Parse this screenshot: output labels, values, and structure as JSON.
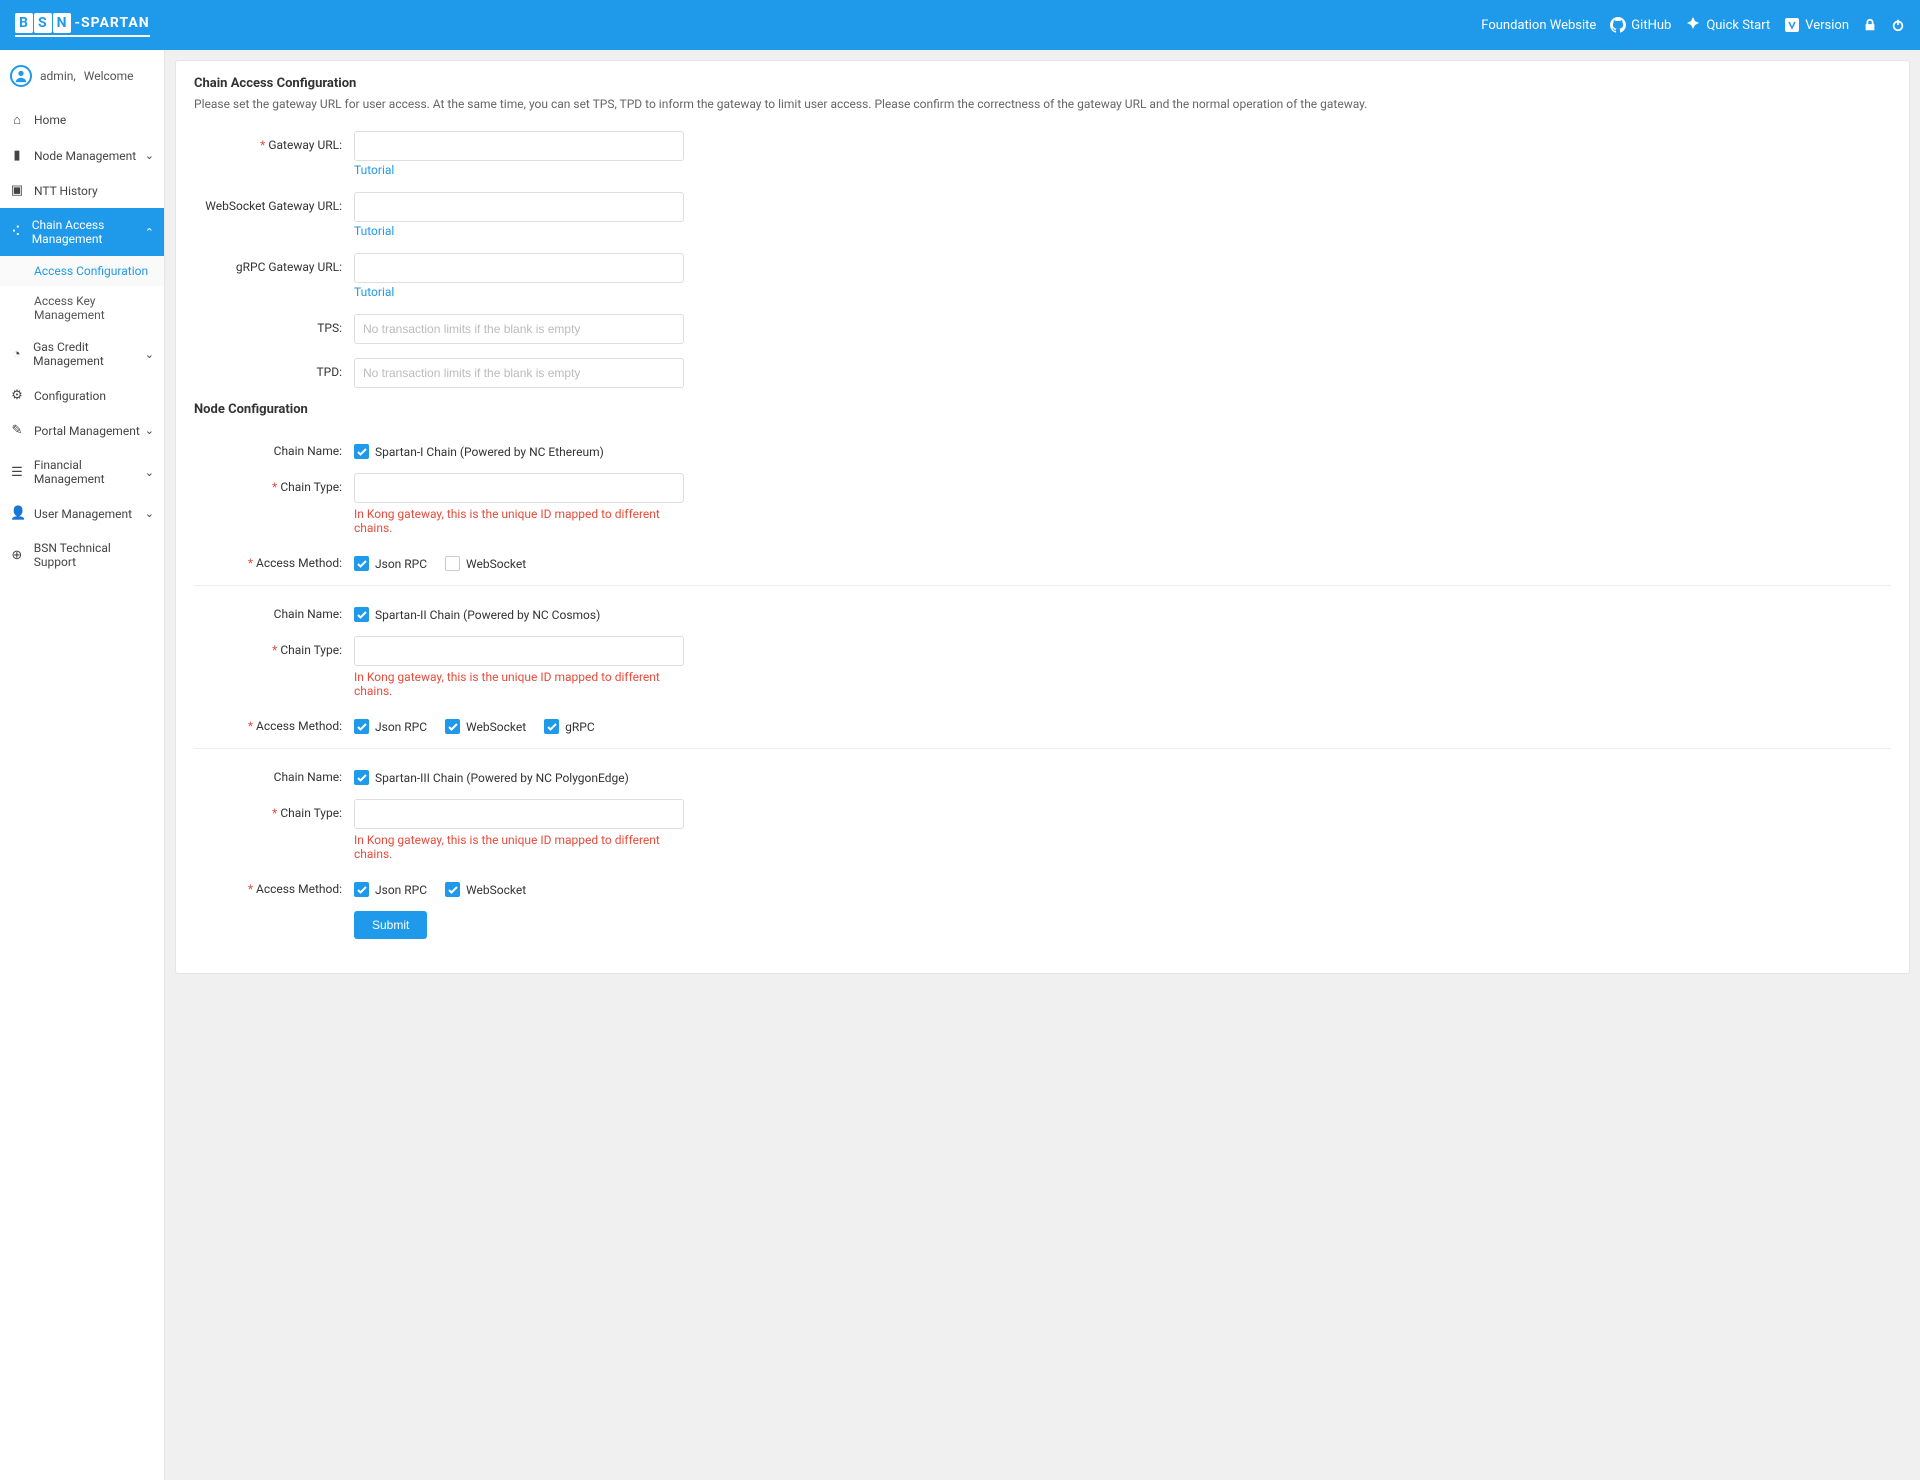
{
  "brand": {
    "b": "B",
    "s": "S",
    "n": "N",
    "spartan": "-SPARTAN"
  },
  "topnav": {
    "foundation": "Foundation Website",
    "github": "GitHub",
    "quickstart": "Quick Start",
    "version": "Version"
  },
  "user": {
    "name": "admin,",
    "welcome": "Welcome"
  },
  "menu": {
    "home": "Home",
    "node": "Node Management",
    "ntt": "NTT History",
    "chain_access": "Chain Access Management",
    "access_config": "Access Configuration",
    "access_key": "Access Key Management",
    "gas_credit": "Gas Credit Management",
    "configuration": "Configuration",
    "portal": "Portal Management",
    "financial": "Financial Management",
    "user_mgmt": "User Management",
    "bsn_support": "BSN Technical Support"
  },
  "section1": {
    "title": "Chain Access Configuration",
    "desc": "Please set the gateway URL for user access. At the same time, you can set TPS, TPD to inform the gateway to limit user access. Please confirm the correctness of the gateway URL and the normal operation of the gateway.",
    "gateway_url_label": "Gateway URL:",
    "ws_gateway_label": "WebSocket Gateway URL:",
    "grpc_gateway_label": "gRPC Gateway URL:",
    "tps_label": "TPS:",
    "tpd_label": "TPD:",
    "tps_placeholder": "No transaction limits if the blank is empty",
    "tpd_placeholder": "No transaction limits if the blank is empty",
    "tutorial": "Tutorial"
  },
  "section2": {
    "title": "Node Configuration",
    "chain_name_label": "Chain Name:",
    "chain_type_label": "Chain Type:",
    "access_method_label": "Access Method:",
    "hint": "In Kong gateway, this is the unique ID mapped to different chains.",
    "chain1": "Spartan-I Chain (Powered by NC Ethereum)",
    "chain2": "Spartan-II Chain (Powered by NC Cosmos)",
    "chain3": "Spartan-III Chain (Powered by NC PolygonEdge)",
    "jsonrpc": "Json RPC",
    "websocket": "WebSocket",
    "grpc": "gRPC",
    "submit": "Submit"
  }
}
